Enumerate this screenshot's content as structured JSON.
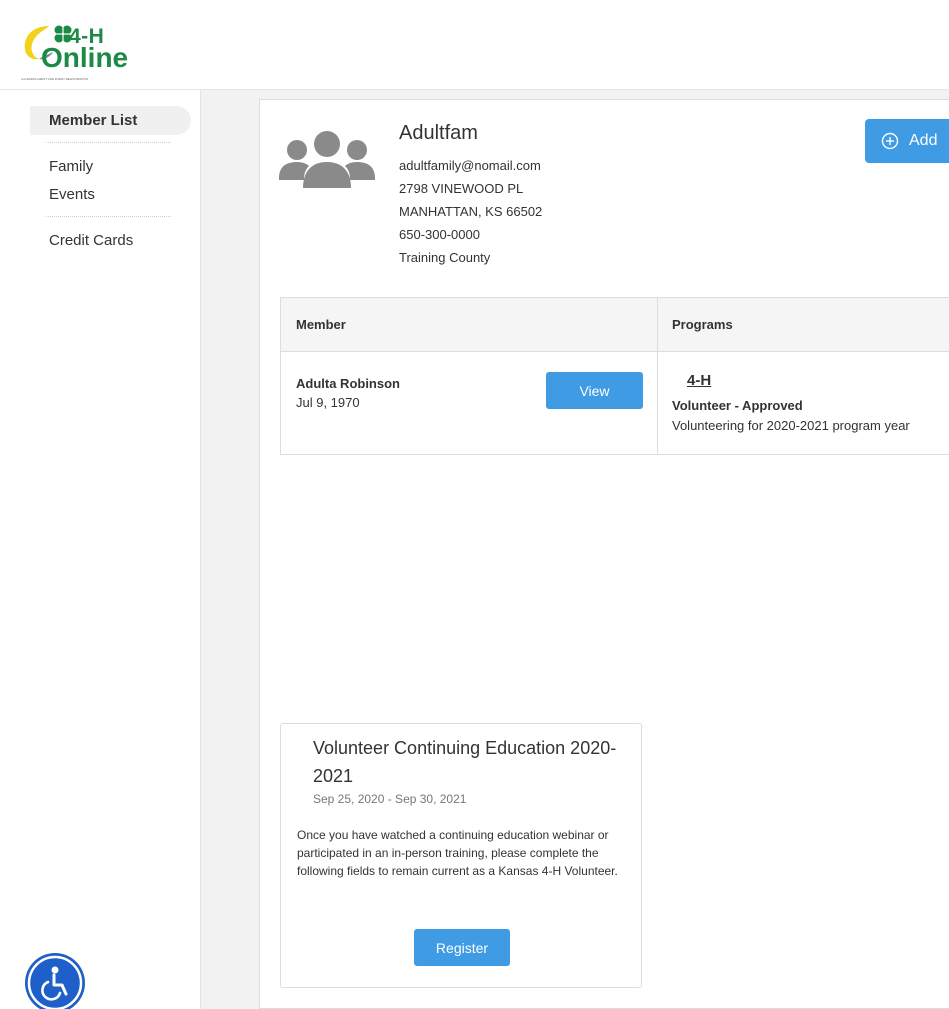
{
  "brand": {
    "logo_line1": "4-H",
    "logo_line2": "Online",
    "logo_tagline": "4-H ENROLLMENT AND EVENT REGISTRATION"
  },
  "sidebar": {
    "items": [
      {
        "label": "Member List",
        "active": true
      },
      {
        "label": "Family"
      },
      {
        "label": "Events"
      },
      {
        "label": "Credit Cards"
      }
    ]
  },
  "family": {
    "name": "Adultfam",
    "email": "adultfamily@nomail.com",
    "address1": "2798 VINEWOOD PL",
    "address2": "MANHATTAN, KS 66502",
    "phone": "650-300-0000",
    "county": "Training County",
    "add_button": "Add"
  },
  "table": {
    "headers": [
      "Member",
      "Programs"
    ],
    "rows": [
      {
        "member_name": "Adulta Robinson",
        "dob": "Jul 9, 1970",
        "view_label": "View",
        "program": "4-H",
        "status": "Volunteer - Approved",
        "description": "Volunteering for 2020-2021 program year"
      }
    ]
  },
  "event": {
    "title": "Volunteer Continuing Education 2020-2021",
    "dates": "Sep 25, 2020 - Sep 30, 2021",
    "description": "Once you have watched a continuing education webinar or participated in an in-person training, please complete the following fields to remain current as a Kansas 4-H Volunteer.",
    "register_label": "Register"
  },
  "colors": {
    "primary": "#3e9be4",
    "brand_green": "#1a8a46",
    "accessibility_blue": "#1f5fc9"
  }
}
